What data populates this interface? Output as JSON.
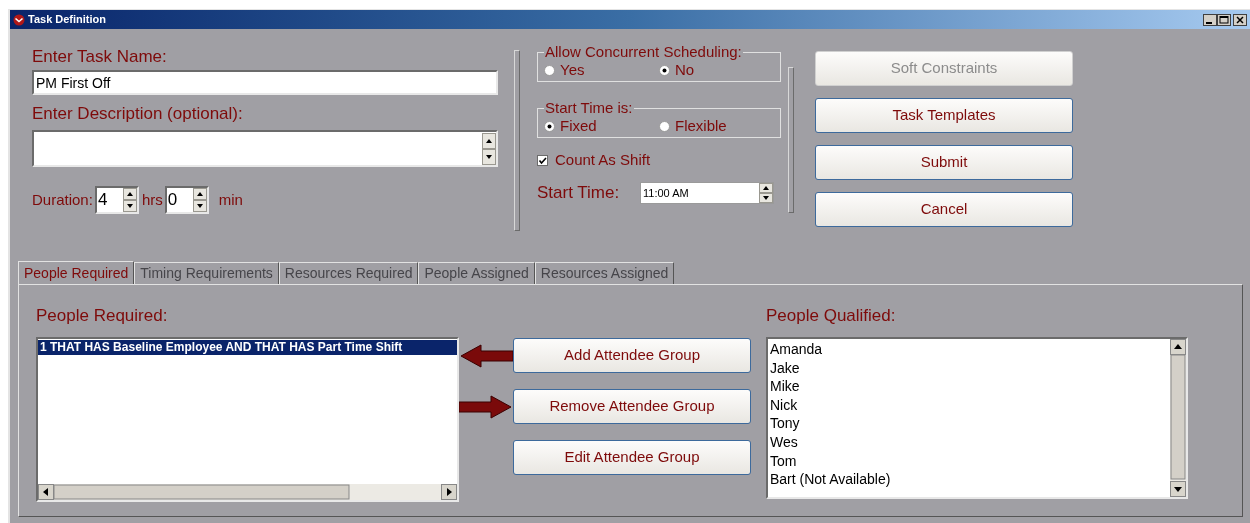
{
  "window": {
    "title": "Task Definition"
  },
  "task_name": {
    "label": "Enter Task Name:",
    "value": "PM First Off"
  },
  "description": {
    "label": "Enter Description (optional):"
  },
  "duration": {
    "label": "Duration:",
    "hours": "4",
    "hours_unit": "hrs",
    "minutes": "0",
    "minutes_unit": "min"
  },
  "concurrent_scheduling": {
    "legend": "Allow Concurrent Scheduling:",
    "options": [
      {
        "label": "Yes",
        "selected": false
      },
      {
        "label": "No",
        "selected": true
      }
    ]
  },
  "start_time_mode": {
    "legend": "Start Time is:",
    "options": [
      {
        "label": "Fixed",
        "selected": true
      },
      {
        "label": "Flexible",
        "selected": false
      }
    ]
  },
  "count_as_shift": {
    "label": "Count As Shift",
    "checked": true
  },
  "start_time": {
    "label": "Start Time:",
    "value": "11:00 AM"
  },
  "buttons": [
    {
      "label": "Soft Constraints",
      "disabled": true
    },
    {
      "label": "Task Templates",
      "disabled": false
    },
    {
      "label": "Submit",
      "disabled": false
    },
    {
      "label": "Cancel",
      "disabled": false
    }
  ],
  "tabs": [
    {
      "label": "People Required",
      "selected": true,
      "disabled": false
    },
    {
      "label": "Timing Requirements",
      "selected": false,
      "disabled": true
    },
    {
      "label": "Resources Required",
      "selected": false,
      "disabled": true
    },
    {
      "label": "People Assigned",
      "selected": false,
      "disabled": true
    },
    {
      "label": "Resources Assigned",
      "selected": false,
      "disabled": true
    }
  ],
  "people_required": {
    "label": "People Required:",
    "items": [
      {
        "text": "1 THAT HAS Baseline Employee AND THAT HAS Part Time Shift",
        "selected": true
      }
    ]
  },
  "attendee_buttons": [
    {
      "label": "Add Attendee Group",
      "kind": "incoming"
    },
    {
      "label": "Remove Attendee Group",
      "kind": "outgoing"
    },
    {
      "label": "Edit Attendee Group",
      "kind": "plain"
    }
  ],
  "people_qualified": {
    "label": "People Qualified:",
    "items": [
      {
        "text": "Amanda",
        "selected": false
      },
      {
        "text": "Jake",
        "selected": false
      },
      {
        "text": "Mike",
        "selected": false
      },
      {
        "text": "Nick",
        "selected": false
      },
      {
        "text": "Tony",
        "selected": false
      },
      {
        "text": "Wes",
        "selected": false
      },
      {
        "text": "Tom",
        "selected": false
      },
      {
        "text": "Bart (Not Available)",
        "selected": false
      }
    ]
  }
}
